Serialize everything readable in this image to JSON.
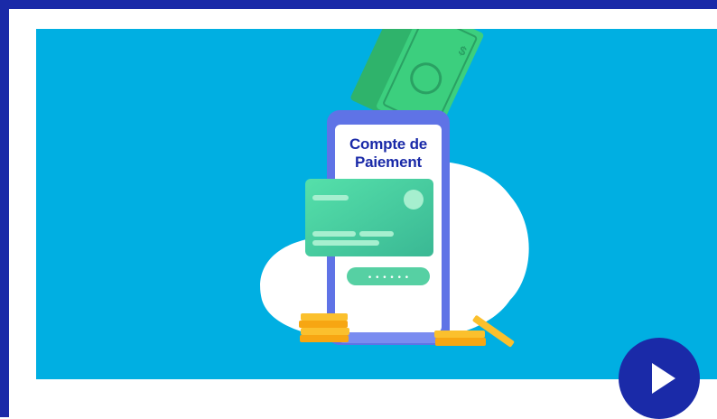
{
  "phone": {
    "title_line1": "Compte de",
    "title_line2": "Paiement",
    "pin_dots": "• • • • • •"
  },
  "card": {
    "color": "#4fd9a6"
  },
  "banknote": {
    "symbol": "$"
  },
  "colors": {
    "brand_blue": "#1a2aa8",
    "hero_background": "#00afe2",
    "coin_gold": "#f9b918"
  },
  "controls": {
    "play_icon": "play-icon"
  }
}
